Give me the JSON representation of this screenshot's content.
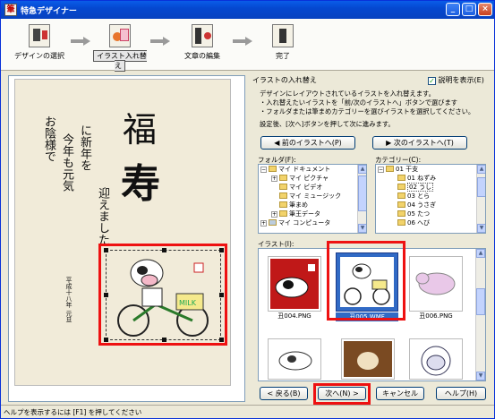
{
  "window": {
    "title": "特急デザイナー",
    "min_label": "_",
    "max_label": "□",
    "close_label": "×"
  },
  "steps": [
    {
      "label": "デザインの選択"
    },
    {
      "label": "イラスト入れ替え"
    },
    {
      "label": "文章の編集"
    },
    {
      "label": "完了"
    }
  ],
  "card": {
    "big1": "福",
    "big2": "寿",
    "line1": "お陰様で",
    "line2": "今年も元気",
    "line3": "に新年を",
    "line4": "迎えました",
    "date": "平成十八年 元旦"
  },
  "panel": {
    "title": "イラストの入れ替え",
    "show_desc_label": "説明を表示(E)",
    "desc_line1": "デザインにレイアウトされているイラストを入れ替えます。",
    "desc_line2": "・入れ替えたいイラストを「前/次のイラストへ」ボタンで選びます",
    "desc_line3": "・フォルダまたは筆まめカテゴリーを選びイラストを選択してください。",
    "desc_line4": "設定後、[次へ]ボタンを押して次に進みます。",
    "prev_illust": "前のイラストへ(P)",
    "next_illust": "次のイラストへ(T)",
    "folder_label": "フォルダ(F):",
    "category_label": "カテゴリー(C):",
    "illust_label": "イラスト(I):"
  },
  "folders": [
    "マイ ドキュメント",
    "マイ ピクチャ",
    "マイ ビデオ",
    "マイ ミュージック",
    "筆まめ",
    "筆王データ",
    "マイ コンピュータ"
  ],
  "categories": [
    "01 干支",
    "01 ねずみ",
    "02 うし",
    "03 とら",
    "04 うさぎ",
    "05 たつ",
    "06 へび"
  ],
  "illustrations": [
    {
      "name": "丑004.PNG"
    },
    {
      "name": "丑005.WMF"
    },
    {
      "name": "丑006.PNG"
    }
  ],
  "buttons": {
    "back": "< 戻る(B)",
    "next": "次へ(N) >",
    "cancel": "キャンセル",
    "help": "ヘルプ(H)"
  },
  "status": "ヘルプを表示するには [F1] を押してください",
  "colors": {
    "highlight": "#e11111",
    "titlebar": "#0548d0",
    "selected_tile": "#316ac5"
  }
}
